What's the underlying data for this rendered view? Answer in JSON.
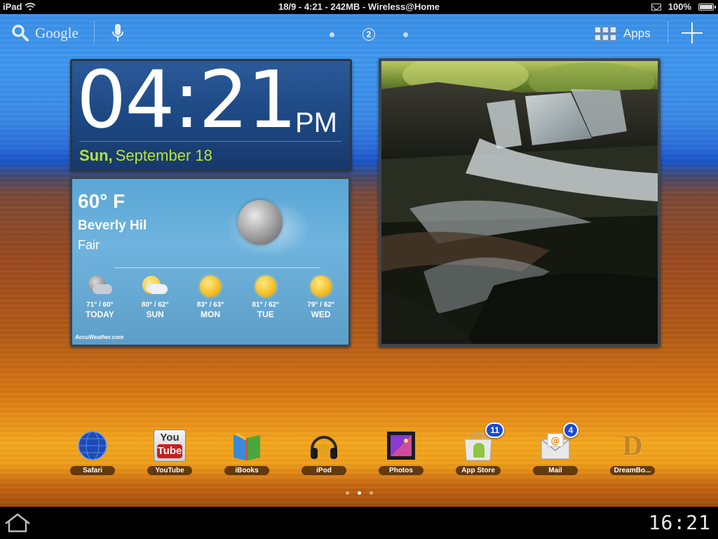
{
  "status_bar": {
    "device": "iPad",
    "center_text": "18/9 - 4:21 - 242MB - Wireless@Home",
    "battery": "100%"
  },
  "top_bar": {
    "search_label": "Google",
    "page_number": "2",
    "apps_label": "Apps"
  },
  "clock_widget": {
    "time": "04:21",
    "ampm": "PM",
    "day": "Sun,",
    "date": "September 18"
  },
  "weather_widget": {
    "temperature": "60° F",
    "city": "Beverly Hil",
    "condition": "Fair",
    "forecast": [
      {
        "range": "71° / 60°",
        "day": "TODAY",
        "icon": "night-cloud-icon"
      },
      {
        "range": "80° / 62°",
        "day": "SUN",
        "icon": "partly-cloudy-icon"
      },
      {
        "range": "83° / 63°",
        "day": "MON",
        "icon": "sun-icon"
      },
      {
        "range": "81° / 62°",
        "day": "TUE",
        "icon": "sun-icon"
      },
      {
        "range": "79° / 62°",
        "day": "WED",
        "icon": "sun-icon"
      }
    ],
    "provider": "AccuWeather.com"
  },
  "dock": {
    "apps": [
      {
        "label": "Safari",
        "icon": "globe-icon"
      },
      {
        "label": "YouTube",
        "icon": "youtube-icon",
        "icon_text_top": "You",
        "icon_text_bottom": "Tube"
      },
      {
        "label": "iBooks",
        "icon": "book-icon"
      },
      {
        "label": "iPod",
        "icon": "headphones-icon"
      },
      {
        "label": "Photos",
        "icon": "photo-frame-icon"
      },
      {
        "label": "App Store",
        "icon": "android-market-icon",
        "badge": "11"
      },
      {
        "label": "Mail",
        "icon": "mail-icon",
        "badge": "4"
      },
      {
        "label": "DreamBo...",
        "icon": "dreamboard-icon",
        "icon_text": "D"
      }
    ]
  },
  "system_bar": {
    "clock": "16:21"
  },
  "colors": {
    "date_green": "#b8e43a",
    "badge_blue": "#1a4ad8"
  }
}
